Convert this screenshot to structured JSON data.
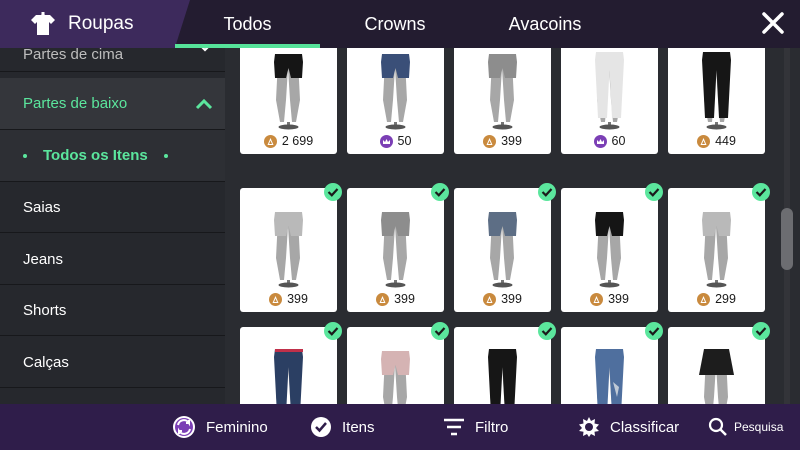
{
  "header": {
    "title": "Roupas",
    "tabs": [
      {
        "label": "Todos",
        "active": true
      },
      {
        "label": "Crowns",
        "active": false
      },
      {
        "label": "Avacoins",
        "active": false
      }
    ],
    "close_icon": "close-icon",
    "accent": "#56e39a"
  },
  "sidebar": {
    "tops_label": "Partes de cima",
    "bottoms_label": "Partes de baixo",
    "all_items_label": "Todos os Itens",
    "items": [
      "Saias",
      "Jeans",
      "Shorts",
      "Calças"
    ]
  },
  "grid": {
    "rows": [
      [
        {
          "price": "2 699",
          "currency": "avacoin",
          "owned": true,
          "type": "shorts-black"
        },
        {
          "price": "50",
          "currency": "crown",
          "owned": true,
          "type": "shorts-blue"
        },
        {
          "price": "399",
          "currency": "avacoin",
          "owned": true,
          "type": "shorts-grey"
        },
        {
          "price": "60",
          "currency": "crown",
          "owned": true,
          "type": "pants-white"
        },
        {
          "price": "449",
          "currency": "avacoin",
          "owned": true,
          "type": "pants-black"
        }
      ],
      [
        {
          "price": "399",
          "currency": "avacoin",
          "owned": true,
          "type": "shorts-lightgrey"
        },
        {
          "price": "399",
          "currency": "avacoin",
          "owned": true,
          "type": "shorts-grey"
        },
        {
          "price": "399",
          "currency": "avacoin",
          "owned": true,
          "type": "shorts-denim"
        },
        {
          "price": "399",
          "currency": "avacoin",
          "owned": true,
          "type": "shorts-black"
        },
        {
          "price": "299",
          "currency": "avacoin",
          "owned": true,
          "type": "shorts-lightgrey"
        }
      ],
      [
        {
          "price": "",
          "currency": "",
          "owned": true,
          "type": "jeans-navy"
        },
        {
          "price": "",
          "currency": "",
          "owned": true,
          "type": "shorts-pink"
        },
        {
          "price": "",
          "currency": "",
          "owned": true,
          "type": "pants-black"
        },
        {
          "price": "",
          "currency": "",
          "owned": true,
          "type": "jeans-ripped"
        },
        {
          "price": "",
          "currency": "",
          "owned": true,
          "type": "skirt-black"
        }
      ]
    ]
  },
  "bottombar": {
    "gender_label": "Feminino",
    "items_label": "Itens",
    "filter_label": "Filtro",
    "sort_label": "Classificar",
    "search_label": "Pesquisa"
  },
  "colors": {
    "avacoin": "#c98a3e",
    "crown": "#7b3fb5",
    "owned_check": "#5be69d"
  }
}
